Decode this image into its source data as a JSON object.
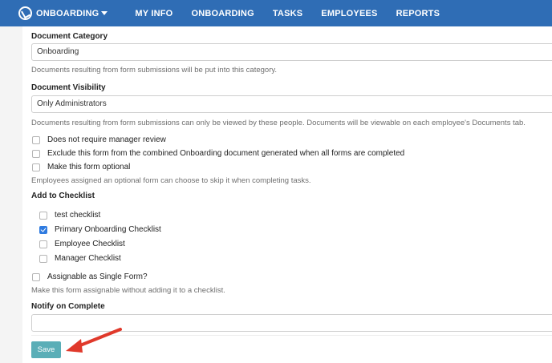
{
  "header": {
    "brand_label": "ONBOARDING",
    "nav": [
      "MY INFO",
      "ONBOARDING",
      "TASKS",
      "EMPLOYEES",
      "REPORTS"
    ]
  },
  "form": {
    "document_category": {
      "label": "Document Category",
      "value": "Onboarding",
      "help": "Documents resulting from form submissions will be put into this category."
    },
    "document_visibility": {
      "label": "Document Visibility",
      "value": "Only Administrators",
      "help": "Documents resulting from form submissions can only be viewed by these people. Documents will be viewable on each employee's Documents tab."
    },
    "options": [
      {
        "label": "Does not require manager review",
        "checked": false
      },
      {
        "label": "Exclude this form from the combined Onboarding document generated when all forms are completed",
        "checked": false
      },
      {
        "label": "Make this form optional",
        "checked": false
      }
    ],
    "optional_help": "Employees assigned an optional form can choose to skip it when completing tasks.",
    "checklist": {
      "label": "Add to Checklist",
      "items": [
        {
          "label": "test checklist",
          "checked": false
        },
        {
          "label": "Primary Onboarding Checklist",
          "checked": true
        },
        {
          "label": "Employee Checklist",
          "checked": false
        },
        {
          "label": "Manager Checklist",
          "checked": false
        }
      ]
    },
    "single_form": {
      "label": "Assignable as Single Form?",
      "checked": false,
      "help": "Make this form assignable without adding it to a checklist."
    },
    "notify": {
      "label": "Notify on Complete",
      "value": ""
    },
    "save_label": "Save"
  },
  "colors": {
    "header_bg": "#2f6db5",
    "save_button": "#5aaeb7",
    "checkbox_checked": "#2f7be0",
    "annotation_arrow": "#e0392b"
  }
}
